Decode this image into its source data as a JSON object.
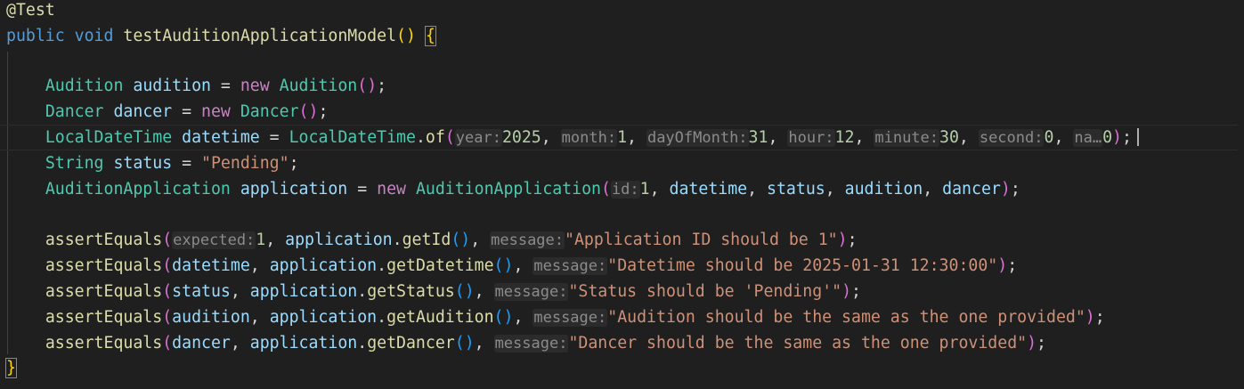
{
  "colors": {
    "background": "#1f1f1f",
    "keyword": "#569cd6",
    "type": "#4ec9b0",
    "variable": "#9cdcfe",
    "function": "#dcdcaa",
    "string": "#ce9178",
    "number": "#b5cea8",
    "new_keyword": "#c586c0",
    "inlay_hint": "#8b8b8b"
  },
  "code": {
    "annotation": "@Test",
    "sig": {
      "public": "public",
      "void": "void",
      "name": "testAuditionApplicationModel",
      "lp": "(",
      "rp": ")",
      "lb": "{"
    },
    "audition_line": {
      "type": "Audition",
      "var": "audition",
      "eq": " = ",
      "new": "new",
      "ctor": "Audition",
      "lp": "(",
      "rp": ")",
      "semi": ";"
    },
    "dancer_line": {
      "type": "Dancer",
      "var": "dancer",
      "eq": " = ",
      "new": "new",
      "ctor": "Dancer",
      "lp": "(",
      "rp": ")",
      "semi": ";"
    },
    "datetime_line": {
      "type": "LocalDateTime",
      "var": "datetime",
      "eq": " = ",
      "cls": "LocalDateTime",
      "dot": ".",
      "fn": "of",
      "lp": "(",
      "rp": ")",
      "semi": ";",
      "h_year": "year:",
      "v_year": "2025",
      "h_month": "month:",
      "v_month": "1",
      "h_day": "dayOfMonth:",
      "v_day": "31",
      "h_hour": "hour:",
      "v_hour": "12",
      "h_minute": "minute:",
      "v_minute": "30",
      "h_second": "second:",
      "v_second": "0",
      "h_nano": "na…",
      "v_nano": "0",
      "comma": ", "
    },
    "status_line": {
      "type": "String",
      "var": "status",
      "eq": " = ",
      "value": "\"Pending\"",
      "semi": ";"
    },
    "app_line": {
      "type": "AuditionApplication",
      "var": "application",
      "eq": " = ",
      "new": "new",
      "ctor": "AuditionApplication",
      "lp": "(",
      "rp": ")",
      "semi": ";",
      "h_id": "id:",
      "v_id": "1",
      "a1": "datetime",
      "a2": "status",
      "a3": "audition",
      "a4": "dancer",
      "comma": ", "
    },
    "asserts": {
      "fn": "assertEquals",
      "lp": "(",
      "rp": ")",
      "semi": ";",
      "comma": ", ",
      "obj": "application",
      "dot": ".",
      "call": "()",
      "h_expected": "expected:",
      "h_message": "message:",
      "a1_exp": "1",
      "a1_get": "getId",
      "a1_msg": "\"Application ID should be 1\"",
      "a2_exp": "datetime",
      "a2_get": "getDatetime",
      "a2_msg": "\"Datetime should be 2025-01-31 12:30:00\"",
      "a3_exp": "status",
      "a3_get": "getStatus",
      "a3_msg": "\"Status should be 'Pending'\"",
      "a4_exp": "audition",
      "a4_get": "getAudition",
      "a4_msg": "\"Audition should be the same as the one provided\"",
      "a5_exp": "dancer",
      "a5_get": "getDancer",
      "a5_msg": "\"Dancer should be the same as the one provided\""
    },
    "close": "}"
  }
}
